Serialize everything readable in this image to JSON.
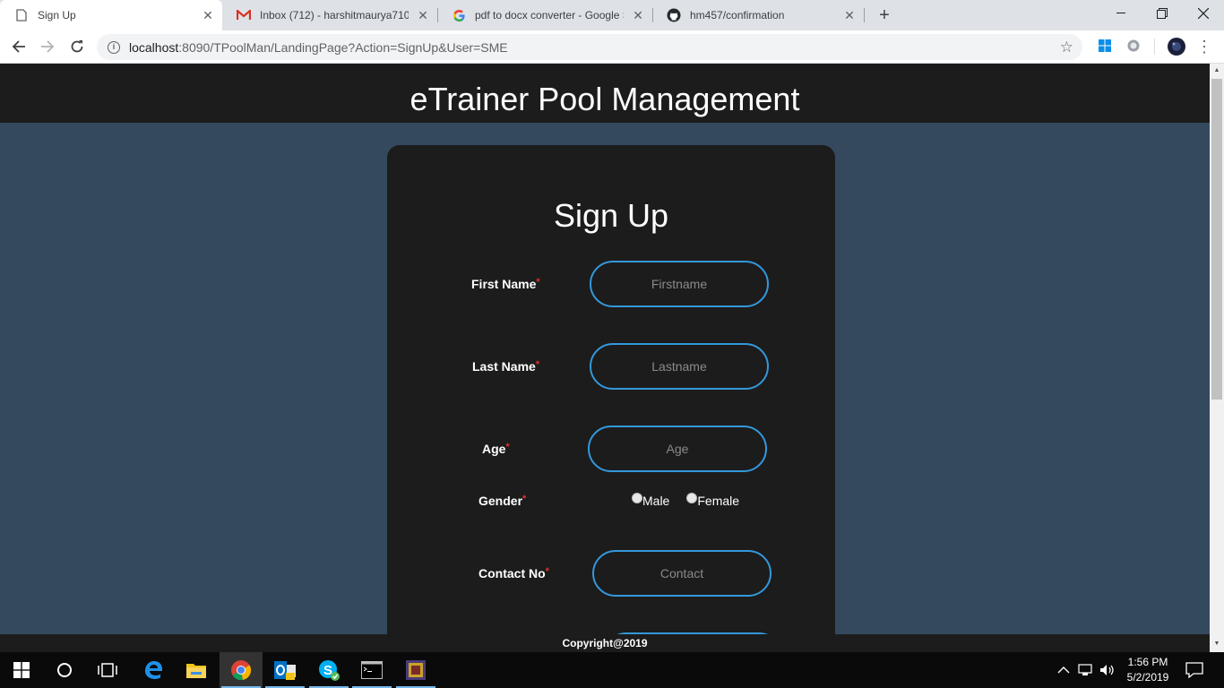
{
  "browser": {
    "tabs": [
      {
        "title": "Sign Up",
        "icon": "document-icon",
        "active": true
      },
      {
        "title": "Inbox (712) - harshitmaurya710@",
        "icon": "gmail-icon",
        "active": false
      },
      {
        "title": "pdf to docx converter - Google S",
        "icon": "google-icon",
        "active": false
      },
      {
        "title": "hm457/confirmation",
        "icon": "github-icon",
        "active": false
      }
    ],
    "url_host": "localhost",
    "url_rest": ":8090/TPoolMan/LandingPage?Action=SignUp&User=SME"
  },
  "page": {
    "header_title": "eTrainer Pool Management",
    "form_title": "Sign Up",
    "fields": {
      "first_name": {
        "label": "First Name",
        "placeholder": "Firstname"
      },
      "last_name": {
        "label": "Last Name",
        "placeholder": "Lastname"
      },
      "age": {
        "label": "Age",
        "placeholder": "Age"
      },
      "gender": {
        "label": "Gender",
        "options": [
          "Male",
          "Female"
        ]
      },
      "contact": {
        "label": "Contact No",
        "placeholder": "Contact"
      }
    },
    "required_mark": "*",
    "footer": "Copyright@2019"
  },
  "taskbar": {
    "time": "1:56 PM",
    "date": "5/2/2019"
  },
  "colors": {
    "page_bg": "#34495e",
    "dark": "#1c1c1c",
    "accent": "#3498db",
    "required": "#e0312b"
  }
}
